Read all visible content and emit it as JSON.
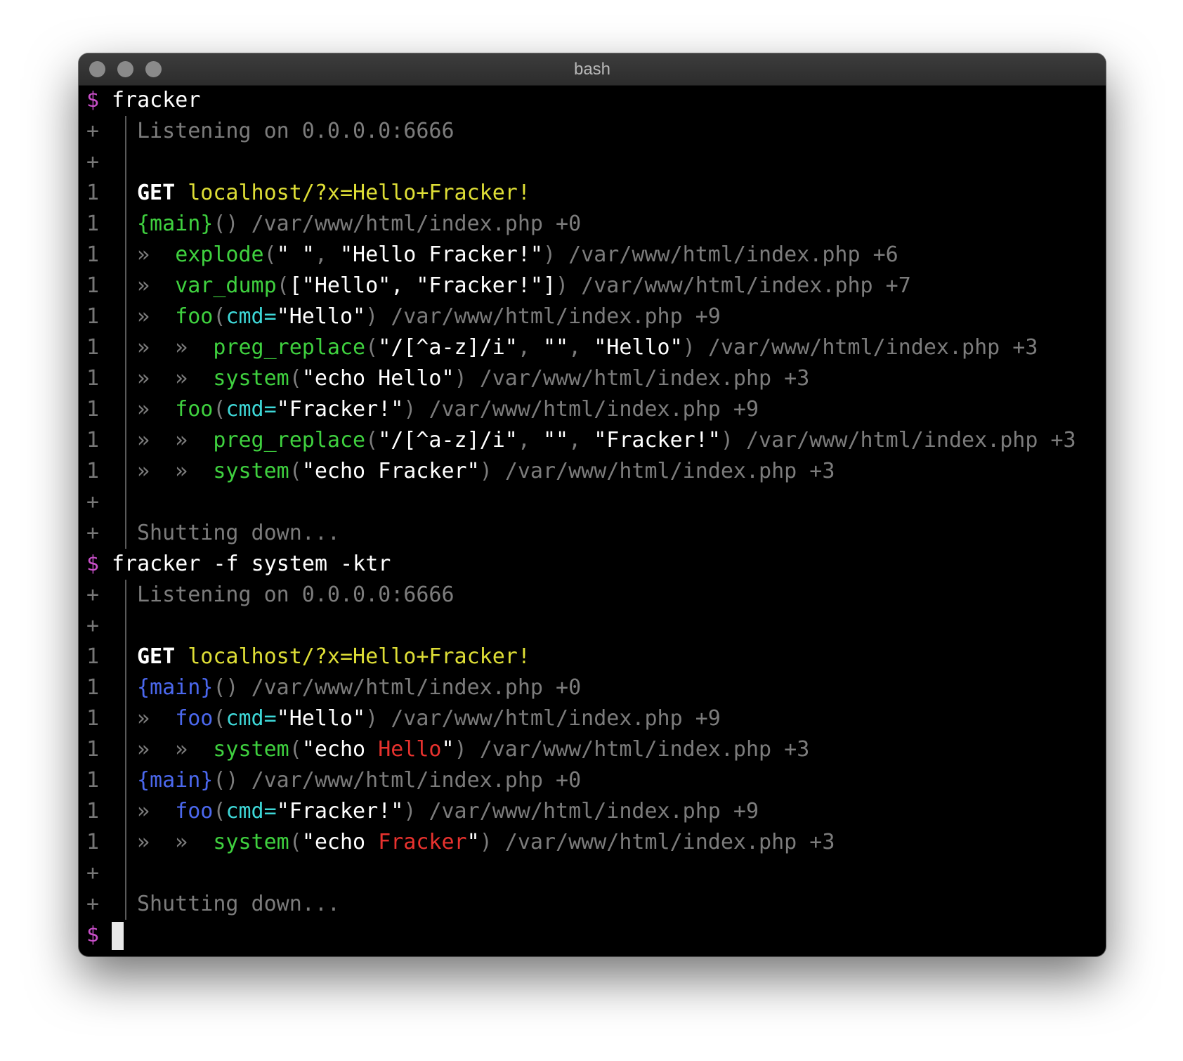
{
  "window": {
    "title": "bash"
  },
  "colors": {
    "prompt": "#c94fc9",
    "dim": "#7c7c7c",
    "yellow": "#dede36",
    "green": "#3fd13f",
    "cyan": "#3ed8d8",
    "blue": "#4b68ee",
    "red": "#e8322e"
  },
  "terminal": {
    "prompt": "$",
    "lines": [
      {
        "type": "cmd",
        "text": "fracker"
      },
      {
        "type": "out",
        "gutter": "+",
        "segments": [
          {
            "t": "Listening on 0.0.0.0:6666",
            "c": "dim"
          }
        ]
      },
      {
        "type": "out",
        "gutter": "+",
        "segments": []
      },
      {
        "type": "out",
        "gutter": "1",
        "segments": [
          {
            "t": "GET",
            "c": "bold"
          },
          {
            "t": " "
          },
          {
            "t": "localhost/?x=Hello+Fracker!",
            "c": "yellow"
          }
        ]
      },
      {
        "type": "out",
        "gutter": "1",
        "segments": [
          {
            "t": "{main}",
            "c": "green"
          },
          {
            "t": "() ",
            "c": "dim"
          },
          {
            "t": "/var/www/html/index.php +0",
            "c": "dim"
          }
        ]
      },
      {
        "type": "out",
        "gutter": "1",
        "segments": [
          {
            "t": "»  ",
            "c": "dim"
          },
          {
            "t": "explode",
            "c": "green"
          },
          {
            "t": "(",
            "c": "dim"
          },
          {
            "t": "\" \"",
            "c": "white"
          },
          {
            "t": ", ",
            "c": "dim"
          },
          {
            "t": "\"Hello Fracker!\"",
            "c": "white"
          },
          {
            "t": ") ",
            "c": "dim"
          },
          {
            "t": "/var/www/html/index.php +6",
            "c": "dim"
          }
        ]
      },
      {
        "type": "out",
        "gutter": "1",
        "segments": [
          {
            "t": "»  ",
            "c": "dim"
          },
          {
            "t": "var_dump",
            "c": "green"
          },
          {
            "t": "(",
            "c": "dim"
          },
          {
            "t": "[\"Hello\", \"Fracker!\"]",
            "c": "white"
          },
          {
            "t": ") ",
            "c": "dim"
          },
          {
            "t": "/var/www/html/index.php +7",
            "c": "dim"
          }
        ]
      },
      {
        "type": "out",
        "gutter": "1",
        "segments": [
          {
            "t": "»  ",
            "c": "dim"
          },
          {
            "t": "foo",
            "c": "green"
          },
          {
            "t": "(",
            "c": "dim"
          },
          {
            "t": "cmd=",
            "c": "cyan"
          },
          {
            "t": "\"Hello\"",
            "c": "white"
          },
          {
            "t": ") ",
            "c": "dim"
          },
          {
            "t": "/var/www/html/index.php +9",
            "c": "dim"
          }
        ]
      },
      {
        "type": "out",
        "gutter": "1",
        "segments": [
          {
            "t": "»  »  ",
            "c": "dim"
          },
          {
            "t": "preg_replace",
            "c": "green"
          },
          {
            "t": "(",
            "c": "dim"
          },
          {
            "t": "\"/[^a-z]/i\"",
            "c": "white"
          },
          {
            "t": ", ",
            "c": "dim"
          },
          {
            "t": "\"\"",
            "c": "white"
          },
          {
            "t": ", ",
            "c": "dim"
          },
          {
            "t": "\"Hello\"",
            "c": "white"
          },
          {
            "t": ") ",
            "c": "dim"
          },
          {
            "t": "/var/www/html/index.php +3",
            "c": "dim"
          }
        ]
      },
      {
        "type": "out",
        "gutter": "1",
        "segments": [
          {
            "t": "»  »  ",
            "c": "dim"
          },
          {
            "t": "system",
            "c": "green"
          },
          {
            "t": "(",
            "c": "dim"
          },
          {
            "t": "\"echo Hello\"",
            "c": "white"
          },
          {
            "t": ") ",
            "c": "dim"
          },
          {
            "t": "/var/www/html/index.php +3",
            "c": "dim"
          }
        ]
      },
      {
        "type": "out",
        "gutter": "1",
        "segments": [
          {
            "t": "»  ",
            "c": "dim"
          },
          {
            "t": "foo",
            "c": "green"
          },
          {
            "t": "(",
            "c": "dim"
          },
          {
            "t": "cmd=",
            "c": "cyan"
          },
          {
            "t": "\"Fracker!\"",
            "c": "white"
          },
          {
            "t": ") ",
            "c": "dim"
          },
          {
            "t": "/var/www/html/index.php +9",
            "c": "dim"
          }
        ]
      },
      {
        "type": "out",
        "gutter": "1",
        "segments": [
          {
            "t": "»  »  ",
            "c": "dim"
          },
          {
            "t": "preg_replace",
            "c": "green"
          },
          {
            "t": "(",
            "c": "dim"
          },
          {
            "t": "\"/[^a-z]/i\"",
            "c": "white"
          },
          {
            "t": ", ",
            "c": "dim"
          },
          {
            "t": "\"\"",
            "c": "white"
          },
          {
            "t": ", ",
            "c": "dim"
          },
          {
            "t": "\"Fracker!\"",
            "c": "white"
          },
          {
            "t": ") ",
            "c": "dim"
          },
          {
            "t": "/var/www/html/index.php +3",
            "c": "dim"
          }
        ]
      },
      {
        "type": "out",
        "gutter": "1",
        "segments": [
          {
            "t": "»  »  ",
            "c": "dim"
          },
          {
            "t": "system",
            "c": "green"
          },
          {
            "t": "(",
            "c": "dim"
          },
          {
            "t": "\"echo Fracker\"",
            "c": "white"
          },
          {
            "t": ") ",
            "c": "dim"
          },
          {
            "t": "/var/www/html/index.php +3",
            "c": "dim"
          }
        ]
      },
      {
        "type": "out",
        "gutter": "+",
        "segments": []
      },
      {
        "type": "out",
        "gutter": "+",
        "segments": [
          {
            "t": "Shutting down...",
            "c": "dim"
          }
        ]
      },
      {
        "type": "cmd",
        "text": "fracker -f system -ktr"
      },
      {
        "type": "out",
        "gutter": "+",
        "segments": [
          {
            "t": "Listening on 0.0.0.0:6666",
            "c": "dim"
          }
        ]
      },
      {
        "type": "out",
        "gutter": "+",
        "segments": []
      },
      {
        "type": "out",
        "gutter": "1",
        "segments": [
          {
            "t": "GET",
            "c": "bold"
          },
          {
            "t": " "
          },
          {
            "t": "localhost/?x=Hello+Fracker!",
            "c": "yellow"
          }
        ]
      },
      {
        "type": "out",
        "gutter": "1",
        "segments": [
          {
            "t": "{main}",
            "c": "blue"
          },
          {
            "t": "() ",
            "c": "dim"
          },
          {
            "t": "/var/www/html/index.php +0",
            "c": "dim"
          }
        ]
      },
      {
        "type": "out",
        "gutter": "1",
        "segments": [
          {
            "t": "»  ",
            "c": "dim"
          },
          {
            "t": "foo",
            "c": "blue"
          },
          {
            "t": "(",
            "c": "dim"
          },
          {
            "t": "cmd=",
            "c": "cyan"
          },
          {
            "t": "\"Hello\"",
            "c": "white"
          },
          {
            "t": ") ",
            "c": "dim"
          },
          {
            "t": "/var/www/html/index.php +9",
            "c": "dim"
          }
        ]
      },
      {
        "type": "out",
        "gutter": "1",
        "segments": [
          {
            "t": "»  »  ",
            "c": "dim"
          },
          {
            "t": "system",
            "c": "green"
          },
          {
            "t": "(",
            "c": "dim"
          },
          {
            "t": "\"echo ",
            "c": "white"
          },
          {
            "t": "Hello",
            "c": "red"
          },
          {
            "t": "\"",
            "c": "white"
          },
          {
            "t": ") ",
            "c": "dim"
          },
          {
            "t": "/var/www/html/index.php +3",
            "c": "dim"
          }
        ]
      },
      {
        "type": "out",
        "gutter": "1",
        "segments": [
          {
            "t": "{main}",
            "c": "blue"
          },
          {
            "t": "() ",
            "c": "dim"
          },
          {
            "t": "/var/www/html/index.php +0",
            "c": "dim"
          }
        ]
      },
      {
        "type": "out",
        "gutter": "1",
        "segments": [
          {
            "t": "»  ",
            "c": "dim"
          },
          {
            "t": "foo",
            "c": "blue"
          },
          {
            "t": "(",
            "c": "dim"
          },
          {
            "t": "cmd=",
            "c": "cyan"
          },
          {
            "t": "\"Fracker!\"",
            "c": "white"
          },
          {
            "t": ") ",
            "c": "dim"
          },
          {
            "t": "/var/www/html/index.php +9",
            "c": "dim"
          }
        ]
      },
      {
        "type": "out",
        "gutter": "1",
        "segments": [
          {
            "t": "»  »  ",
            "c": "dim"
          },
          {
            "t": "system",
            "c": "green"
          },
          {
            "t": "(",
            "c": "dim"
          },
          {
            "t": "\"echo ",
            "c": "white"
          },
          {
            "t": "Fracker",
            "c": "red"
          },
          {
            "t": "\"",
            "c": "white"
          },
          {
            "t": ") ",
            "c": "dim"
          },
          {
            "t": "/var/www/html/index.php +3",
            "c": "dim"
          }
        ]
      },
      {
        "type": "out",
        "gutter": "+",
        "segments": []
      },
      {
        "type": "out",
        "gutter": "+",
        "segments": [
          {
            "t": "Shutting down...",
            "c": "dim"
          }
        ]
      },
      {
        "type": "prompt_cursor"
      }
    ]
  }
}
